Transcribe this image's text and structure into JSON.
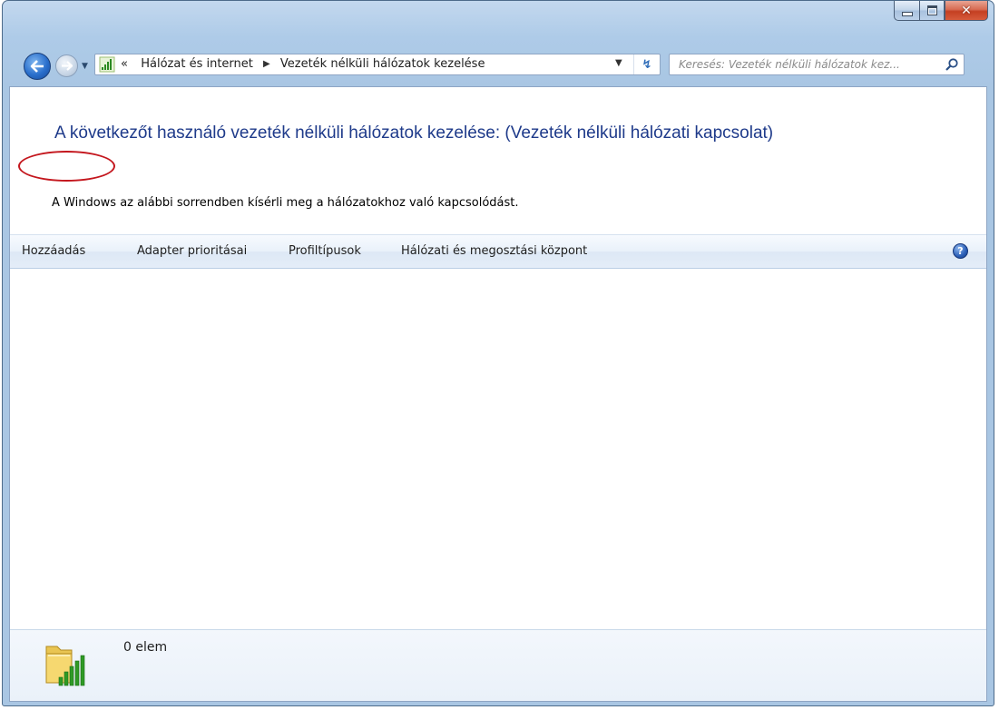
{
  "address_bar": {
    "overflow": "«",
    "crumbs": [
      "Hálózat és internet",
      "Vezeték nélküli hálózatok kezelése"
    ]
  },
  "search": {
    "placeholder": "Keresés: Vezeték nélküli hálózatok kez..."
  },
  "content": {
    "title": "A következőt használó vezeték nélküli hálózatok kezelése: (Vezeték nélküli hálózati kapcsolat)",
    "subtitle": "A Windows az alábbi sorrendben kísérli meg a hálózatokhoz való kapcsolódást."
  },
  "toolbar": {
    "add": "Hozzáadás",
    "adapter": "Adapter prioritásai",
    "profile_types": "Profiltípusok",
    "network_center": "Hálózati és megosztási központ",
    "help": "?"
  },
  "details": {
    "item_count": "0 elem"
  },
  "colors": {
    "title": "#1e3a8a",
    "highlight": "#c4171e",
    "close_button": "#c43f22"
  },
  "icons": [
    "back-arrow-icon",
    "forward-arrow-icon",
    "network-signal-icon",
    "refresh-icon",
    "search-icon",
    "help-icon",
    "wireless-folder-icon"
  ]
}
